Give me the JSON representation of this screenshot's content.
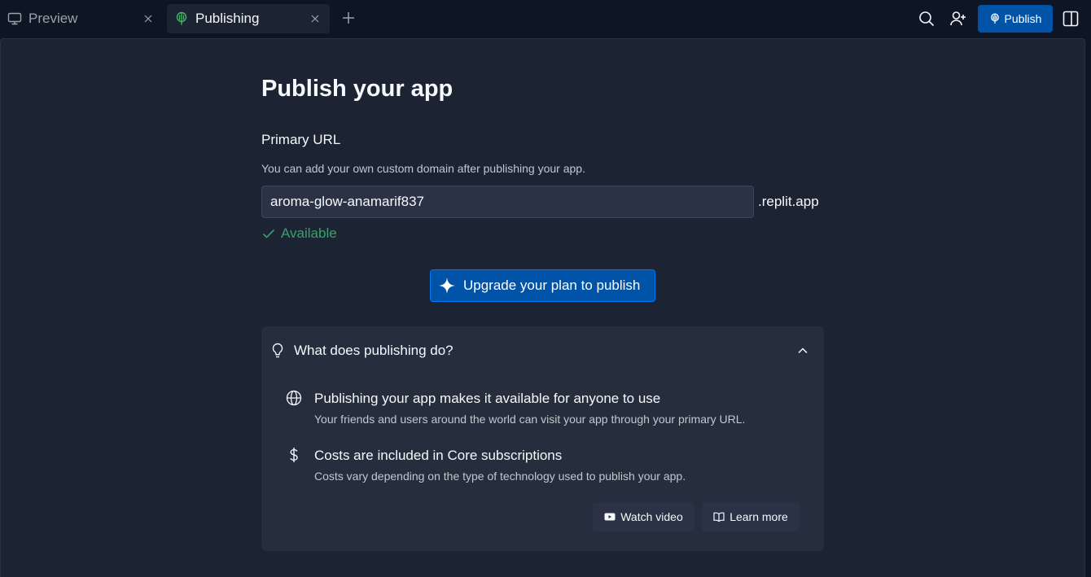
{
  "tabs": [
    {
      "label": "Preview",
      "icon": "monitor-icon",
      "active": false
    },
    {
      "label": "Publishing",
      "icon": "publishing-icon",
      "active": true
    }
  ],
  "toolbar": {
    "publish_label": "Publish",
    "search_icon": "search-icon",
    "invite_icon": "user-plus-icon",
    "layout_icon": "sidebar-layout-icon"
  },
  "page": {
    "title": "Publish your app",
    "primary_url_label": "Primary URL",
    "primary_url_help": "You can add your own custom domain after publishing your app.",
    "url_value": "aroma-glow-anamarif837",
    "url_suffix": ".replit.app",
    "availability": "Available",
    "upgrade_label": "Upgrade your plan to publish"
  },
  "faq": {
    "title": "What does publishing do?",
    "items": [
      {
        "icon": "globe-icon",
        "title": "Publishing your app makes it available for anyone to use",
        "description": "Your friends and users around the world can visit your app through your primary URL."
      },
      {
        "icon": "dollar-icon",
        "title": "Costs are included in Core subscriptions",
        "description": "Costs vary depending on the type of technology used to publish your app."
      }
    ],
    "watch_video_label": "Watch video",
    "learn_more_label": "Learn more"
  },
  "colors": {
    "accent": "#0053a6",
    "success": "#38a169",
    "background": "#0e1525",
    "surface": "#1c2333"
  }
}
